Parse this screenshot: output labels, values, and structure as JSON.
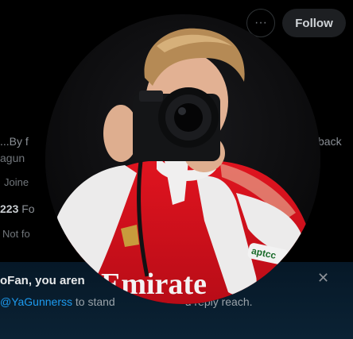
{
  "header": {
    "more_symbol": "···",
    "follow_label": "Follow"
  },
  "profile": {
    "bio_line_1": "...By f",
    "bio_line_2": "agun",
    "bio_right_fragment": "back",
    "joined_text": "Joine",
    "following_count": "223",
    "following_suffix": " Fo",
    "followers_note": "Not fo"
  },
  "banner": {
    "title": "oFan, you aren",
    "mention": "@YaGunnerss",
    "text_after_mention": " to stand",
    "text_tail": "d reply reach.",
    "close_symbol": "✕"
  },
  "avatar": {
    "shirt_text": "Emirate",
    "badge_text": "aptcc",
    "colors": {
      "shirt_red": "#d0101d",
      "sleeve_white": "#ecebeb",
      "camera": "#111214"
    }
  }
}
